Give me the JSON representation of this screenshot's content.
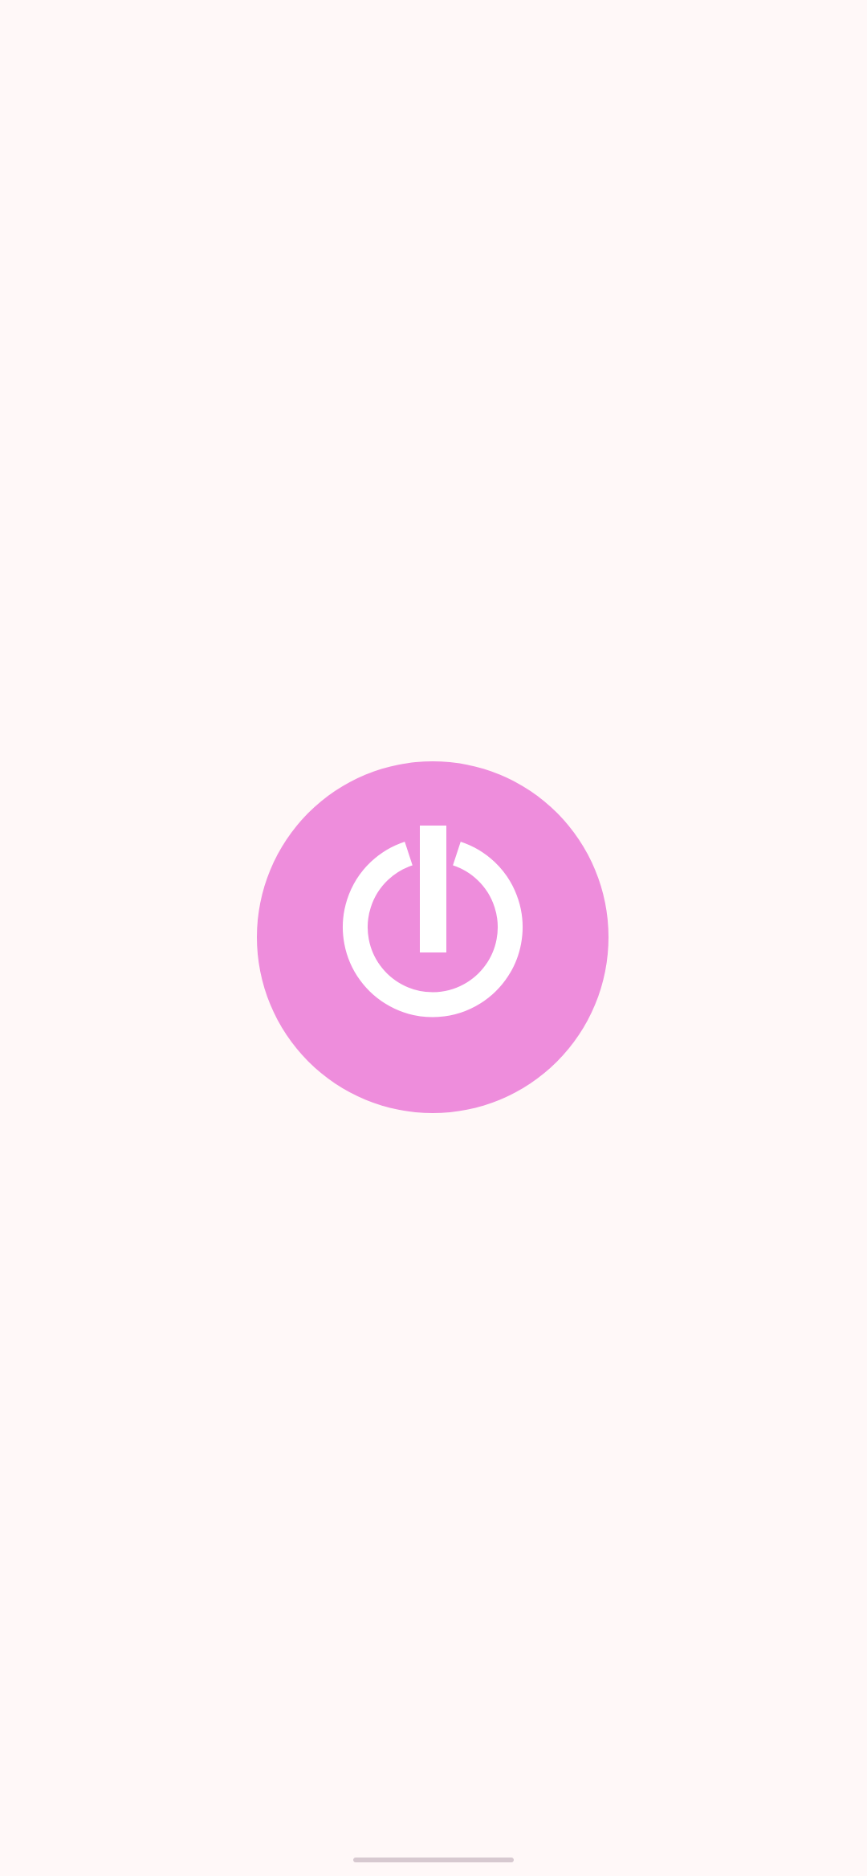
{
  "screen": {
    "background_color": "#FFF8F8"
  },
  "power_button": {
    "icon": "power-icon",
    "fill_color": "#EE8DDC",
    "icon_color": "#FFFFFF"
  },
  "navigation": {
    "home_indicator_color": "#D7C9D0"
  }
}
